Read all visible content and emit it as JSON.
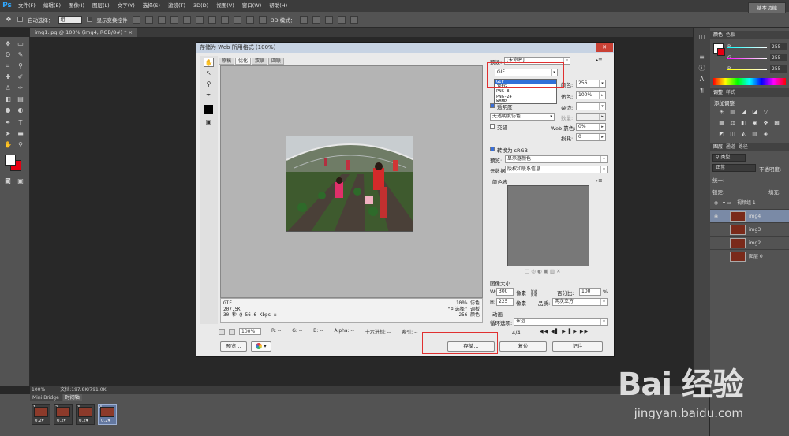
{
  "app": {
    "logo": "Ps",
    "menu": [
      "文件(F)",
      "编辑(E)",
      "图像(I)",
      "图层(L)",
      "文字(Y)",
      "选择(S)",
      "滤镜(T)",
      "3D(D)",
      "视图(V)",
      "窗口(W)",
      "帮助(H)"
    ],
    "window_controls": [
      "—",
      "▢",
      "✕"
    ]
  },
  "options_bar": {
    "auto_select_label": "自动选择：",
    "auto_select_value": "组",
    "show_transform_label": "显示变换控件",
    "mode_3d_label": "3D 模式：",
    "workspace_button": "基本功能"
  },
  "document": {
    "tab_title": "img1.jpg @ 100% (img4, RGB/8#) *  ×",
    "status_zoom": "100%",
    "status_doc": "文档:197.8K/791.0K"
  },
  "dialog": {
    "title": "存储为 Web 所用格式 (100%)",
    "close": "✕",
    "view_tabs": [
      "原稿",
      "优化",
      "双联",
      "四联"
    ],
    "info_left": [
      "GIF",
      "207.5K",
      "30 秒 @ 56.6 Kbps  ≡"
    ],
    "info_right": [
      "100% 仿色",
      "\"可选择\" 调板",
      "256 颜色"
    ],
    "zoom": "100%",
    "readouts": [
      "R: --",
      "G: --",
      "B: --",
      "Alpha: --",
      "十六进制: --",
      "索引: --"
    ],
    "preset_label": "预设:",
    "preset_value": "[未命名]",
    "format_value": "GIF",
    "format_options": [
      "GIF",
      "JPEG",
      "PNG-8",
      "PNG-24",
      "WBMP"
    ],
    "colors_label": "颜色:",
    "colors_value": "256",
    "dither_label": "仿色:",
    "dither_value": "100%",
    "matte_label": "杂边:",
    "transparency_label": "透明度",
    "amount_label": "数量:",
    "transparency_dither": "无透明度仿色",
    "interlaced_label": "交错",
    "web_snap_label": "Web 靠色:",
    "web_snap_value": "0%",
    "lossy_label": "损耗:",
    "lossy_value": "0",
    "convert_srgb": "转换为 sRGB",
    "preview_label": "预览:",
    "preview_value": "显示器颜色",
    "metadata_label": "元数据:",
    "metadata_value": "版权和联系信息",
    "color_table_label": "颜色表",
    "image_size_label": "图像大小",
    "w_label": "W:",
    "w_value": "300",
    "h_label": "H:",
    "h_value": "225",
    "unit": "像素",
    "percent_label": "百分比:",
    "percent_value": "100",
    "percent_unit": "%",
    "quality_label": "品质:",
    "quality_value": "两次立方",
    "animation_label": "动画",
    "loop_label": "循环选项:",
    "loop_value": "永远",
    "frame_counter": "4/4",
    "btn_preview": "预览...",
    "btn_save": "存储...",
    "btn_reset": "复位",
    "btn_remember": "记住"
  },
  "panels": {
    "color_tabs": [
      "颜色",
      "色板"
    ],
    "r_label": "R",
    "r_value": "255",
    "g_label": "G",
    "g_value": "255",
    "b_label": "B",
    "b_value": "255",
    "adjust_tabs": [
      "调整",
      "样式"
    ],
    "adjust_title": "添加调整",
    "layer_tabs": [
      "图层",
      "通道",
      "路径"
    ],
    "kind_value": "类型",
    "blend_value": "正常",
    "opacity_label": "不透明度:",
    "lock_label": "锁定:",
    "fill_label": "填充:",
    "unify_label": "统一:",
    "layers": [
      {
        "name": "视频组 1"
      },
      {
        "name": "img4"
      },
      {
        "name": "img3"
      },
      {
        "name": "img2"
      },
      {
        "name": "图层 0"
      }
    ]
  },
  "timeline": {
    "tabs": [
      "Mini Bridge",
      "时间轴"
    ],
    "frames": [
      {
        "num": "1",
        "delay": "0.2▾"
      },
      {
        "num": "2",
        "delay": "0.2▾"
      },
      {
        "num": "3",
        "delay": "0.2▾"
      },
      {
        "num": "4",
        "delay": "0.2▾"
      }
    ]
  },
  "watermark": {
    "brand": "Bai 经验",
    "url": "jingyan.baidu.com"
  },
  "colors": {
    "foreground": "#ffffff",
    "background": "#e60012",
    "accent": "#3170d8",
    "highlight_box": "#e03030"
  }
}
